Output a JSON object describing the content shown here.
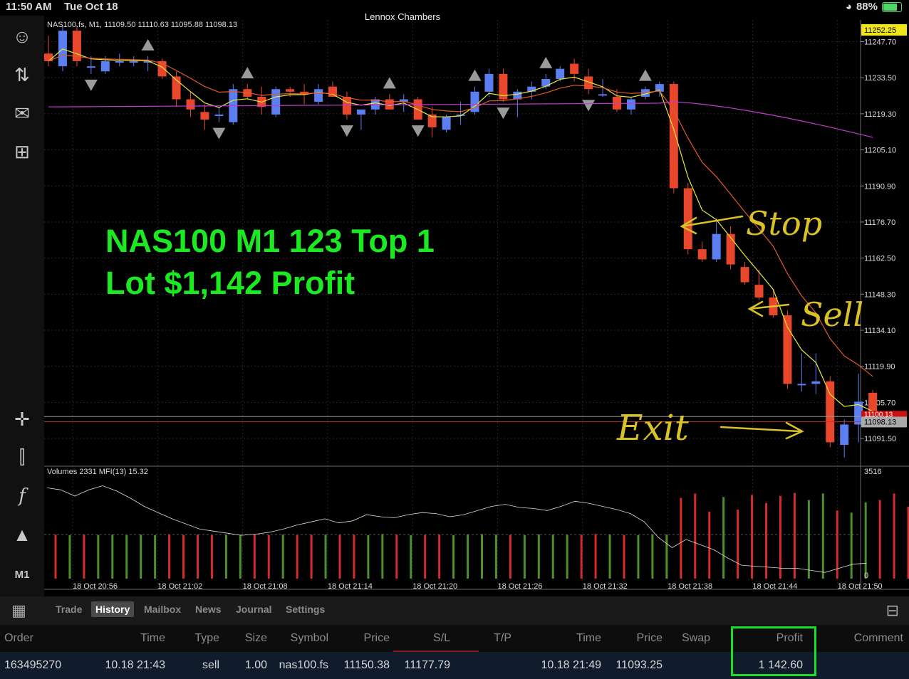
{
  "status": {
    "time": "11:50 AM",
    "date": "Tue Oct 18",
    "battery": "88%"
  },
  "window_title": "Lennox Chambers",
  "chart": {
    "info": "NAS100.fs, M1, 11109.50 11110.63 11095.88 11098.13",
    "current_price_top": "11252.25",
    "current_price_bid": "11098.13",
    "current_price_ask": "11100.13",
    "price_ticks": [
      "11247.70",
      "11233.50",
      "11219.30",
      "11205.10",
      "11190.90",
      "11176.70",
      "11162.50",
      "11148.30",
      "11134.10",
      "11119.90",
      "11105.70",
      "11091.50"
    ],
    "volume_info": "Volumes 2331 MFI(13) 15.32",
    "volume_max": "3516",
    "volume_min": "0",
    "time_ticks": [
      "18 Oct 20:56",
      "18 Oct 21:02",
      "18 Oct 21:08",
      "18 Oct 21:14",
      "18 Oct 21:20",
      "18 Oct 21:26",
      "18 Oct 21:32",
      "18 Oct 21:38",
      "18 Oct 21:44",
      "18 Oct 21:50"
    ],
    "overlay_line1": "NAS100 M1 123 Top 1",
    "overlay_line2": "Lot $1,142 Profit",
    "annot_stop": "Stop",
    "annot_sell": "Sell",
    "annot_exit": "Exit",
    "colors": {
      "up": "#5b7ff0",
      "down": "#e8472c",
      "text_green": "#1bea22",
      "handwriting": "#d9c227",
      "ma_slow": "#c23ad0",
      "ma_fast": "#e8e83a",
      "ma_mid": "#e05a2c"
    }
  },
  "chart_data": {
    "type": "candlestick",
    "candles": [
      {
        "o": 11243,
        "h": 11250,
        "l": 11238,
        "c": 11240
      },
      {
        "o": 11238,
        "h": 11254,
        "l": 11236,
        "c": 11252
      },
      {
        "o": 11252,
        "h": 11254,
        "l": 11238,
        "c": 11240
      },
      {
        "o": 11238,
        "h": 11242,
        "l": 11235,
        "c": 11238
      },
      {
        "o": 11236,
        "h": 11242,
        "l": 11235,
        "c": 11240
      },
      {
        "o": 11240,
        "h": 11243,
        "l": 11238,
        "c": 11240
      },
      {
        "o": 11240,
        "h": 11242,
        "l": 11238,
        "c": 11240
      },
      {
        "o": 11240,
        "h": 11242,
        "l": 11236,
        "c": 11240
      },
      {
        "o": 11240,
        "h": 11241,
        "l": 11233,
        "c": 11234
      },
      {
        "o": 11234,
        "h": 11236,
        "l": 11222,
        "c": 11225
      },
      {
        "o": 11225,
        "h": 11228,
        "l": 11218,
        "c": 11221
      },
      {
        "o": 11220,
        "h": 11223,
        "l": 11213,
        "c": 11217
      },
      {
        "o": 11219,
        "h": 11222,
        "l": 11216,
        "c": 11219
      },
      {
        "o": 11216,
        "h": 11231,
        "l": 11215,
        "c": 11229
      },
      {
        "o": 11229,
        "h": 11231,
        "l": 11225,
        "c": 11226
      },
      {
        "o": 11226,
        "h": 11230,
        "l": 11219,
        "c": 11222
      },
      {
        "o": 11219,
        "h": 11230,
        "l": 11218,
        "c": 11229
      },
      {
        "o": 11229,
        "h": 11230,
        "l": 11226,
        "c": 11228
      },
      {
        "o": 11228,
        "h": 11231,
        "l": 11223,
        "c": 11227
      },
      {
        "o": 11224,
        "h": 11231,
        "l": 11223,
        "c": 11229
      },
      {
        "o": 11230,
        "h": 11232,
        "l": 11226,
        "c": 11226
      },
      {
        "o": 11226,
        "h": 11228,
        "l": 11217,
        "c": 11219
      },
      {
        "o": 11219,
        "h": 11221,
        "l": 11213,
        "c": 11221
      },
      {
        "o": 11221,
        "h": 11226,
        "l": 11219,
        "c": 11225
      },
      {
        "o": 11225,
        "h": 11227,
        "l": 11222,
        "c": 11221
      },
      {
        "o": 11224,
        "h": 11227,
        "l": 11220,
        "c": 11225
      },
      {
        "o": 11225,
        "h": 11226,
        "l": 11217,
        "c": 11217
      },
      {
        "o": 11219,
        "h": 11222,
        "l": 11210,
        "c": 11214
      },
      {
        "o": 11213,
        "h": 11219,
        "l": 11212,
        "c": 11218
      },
      {
        "o": 11219,
        "h": 11224,
        "l": 11215,
        "c": 11219
      },
      {
        "o": 11220,
        "h": 11230,
        "l": 11219,
        "c": 11228
      },
      {
        "o": 11228,
        "h": 11237,
        "l": 11226,
        "c": 11235
      },
      {
        "o": 11235,
        "h": 11237,
        "l": 11224,
        "c": 11225
      },
      {
        "o": 11225,
        "h": 11229,
        "l": 11218,
        "c": 11228
      },
      {
        "o": 11228,
        "h": 11232,
        "l": 11225,
        "c": 11230
      },
      {
        "o": 11230,
        "h": 11235,
        "l": 11229,
        "c": 11233
      },
      {
        "o": 11233,
        "h": 11238,
        "l": 11232,
        "c": 11237
      },
      {
        "o": 11239,
        "h": 11241,
        "l": 11232,
        "c": 11235
      },
      {
        "o": 11234,
        "h": 11237,
        "l": 11227,
        "c": 11229
      },
      {
        "o": 11227,
        "h": 11233,
        "l": 11226,
        "c": 11227
      },
      {
        "o": 11226,
        "h": 11229,
        "l": 11220,
        "c": 11221
      },
      {
        "o": 11221,
        "h": 11226,
        "l": 11219,
        "c": 11225
      },
      {
        "o": 11226,
        "h": 11230,
        "l": 11225,
        "c": 11229
      },
      {
        "o": 11228,
        "h": 11232,
        "l": 11226,
        "c": 11231
      },
      {
        "o": 11231,
        "h": 11232,
        "l": 11188,
        "c": 11190
      },
      {
        "o": 11190,
        "h": 11192,
        "l": 11164,
        "c": 11166
      },
      {
        "o": 11166,
        "h": 11169,
        "l": 11161,
        "c": 11162
      },
      {
        "o": 11162,
        "h": 11178,
        "l": 11161,
        "c": 11172
      },
      {
        "o": 11172,
        "h": 11175,
        "l": 11158,
        "c": 11160
      },
      {
        "o": 11159,
        "h": 11161,
        "l": 11152,
        "c": 11153
      },
      {
        "o": 11152,
        "h": 11158,
        "l": 11146,
        "c": 11147
      },
      {
        "o": 11147,
        "h": 11150,
        "l": 11139,
        "c": 11140
      },
      {
        "o": 11140,
        "h": 11142,
        "l": 11111,
        "c": 11113
      },
      {
        "o": 11113,
        "h": 11125,
        "l": 11110,
        "c": 11113
      },
      {
        "o": 11113,
        "h": 11125,
        "l": 11109,
        "c": 11114
      },
      {
        "o": 11114,
        "h": 11116,
        "l": 11088,
        "c": 11090
      },
      {
        "o": 11089,
        "h": 11099,
        "l": 11084,
        "c": 11097
      },
      {
        "o": 11097,
        "h": 11117,
        "l": 11090,
        "c": 11106
      },
      {
        "o": 11109.5,
        "h": 11110.63,
        "l": 11095.88,
        "c": 11098.13
      }
    ],
    "fractals_up": [
      7,
      14,
      24,
      30,
      35,
      42
    ],
    "fractals_down": [
      3,
      12,
      21,
      26,
      32,
      38
    ],
    "volumes": [
      1500,
      1480,
      1500,
      1490,
      1500,
      1480,
      1500,
      1480,
      1500,
      1490,
      1500,
      1480,
      1500,
      1490,
      1520,
      1490,
      1500,
      1480,
      1500,
      1500,
      1490,
      1500,
      1480,
      1520,
      1500,
      1480,
      1490,
      1500,
      1480,
      1500,
      1520,
      1500,
      1490,
      1480,
      1510,
      1500,
      1490,
      1500,
      1520,
      1500,
      1490,
      1480,
      1510,
      1500,
      2750,
      2900,
      2280,
      2780,
      2350,
      2850,
      2580,
      2820,
      2920,
      2680,
      2900,
      2320,
      2250,
      2600,
      2680,
      2900,
      2450
    ],
    "mfi": [
      88,
      86,
      80,
      86,
      90,
      85,
      78,
      70,
      64,
      58,
      53,
      48,
      46,
      44,
      42,
      43,
      45,
      48,
      52,
      55,
      58,
      54,
      56,
      62,
      60,
      59,
      62,
      64,
      63,
      60,
      62,
      66,
      70,
      72,
      69,
      68,
      66,
      70,
      75,
      73,
      70,
      67,
      63,
      55,
      40,
      30,
      38,
      33,
      28,
      20,
      13,
      12,
      11,
      10,
      10,
      8,
      6,
      10,
      14,
      15
    ],
    "ylim": [
      11082,
      11254
    ]
  },
  "bottombar": {
    "tabs": [
      "Trade",
      "History",
      "Mailbox",
      "News",
      "Journal",
      "Settings"
    ],
    "active_tab": "History"
  },
  "history": {
    "headers": {
      "order": "Order",
      "time": "Time",
      "type": "Type",
      "size": "Size",
      "symbol": "Symbol",
      "price": "Price",
      "sl": "S/L",
      "tp": "T/P",
      "time2": "Time",
      "price2": "Price",
      "swap": "Swap",
      "profit": "Profit",
      "comment": "Comment"
    },
    "row": {
      "order": "163495270",
      "time": "10.18 21:43",
      "type": "sell",
      "size": "1.00",
      "symbol": "nas100.fs",
      "price": "11150.38",
      "sl": "11177.79",
      "tp": "",
      "time2": "10.18 21:49",
      "price2": "11093.25",
      "swap": "",
      "profit": "1 142.60",
      "comment": ""
    }
  }
}
